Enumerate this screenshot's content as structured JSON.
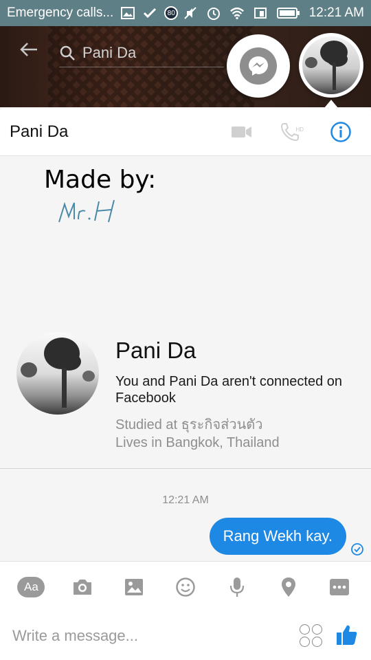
{
  "status_bar": {
    "carrier_text": "Emergency calls...",
    "badge": "80",
    "time": "12:21 AM"
  },
  "search": {
    "query": "Pani Da"
  },
  "chat": {
    "title": "Pani Da",
    "hd_label": "HD",
    "accent_color": "#1e88e5"
  },
  "overlay": {
    "made_by": "Made by:",
    "signature": "Mr.H"
  },
  "profile": {
    "name": "Pani Da",
    "connection_text": "You and Pani Da aren't connected on Facebook",
    "studied": "Studied at ธุระกิจส่วนตัว",
    "lives": "Lives in Bangkok, Thailand"
  },
  "messages": [
    {
      "time": "12:21 AM",
      "text": "Rang Wekh kay.",
      "status": "seen"
    }
  ],
  "toolbar": {
    "aa_label": "Aa",
    "icons": [
      "aa-icon",
      "camera-icon",
      "gallery-icon",
      "emoji-icon",
      "microphone-icon",
      "location-icon",
      "more-icon"
    ]
  },
  "composer": {
    "placeholder": "Write a message..."
  }
}
